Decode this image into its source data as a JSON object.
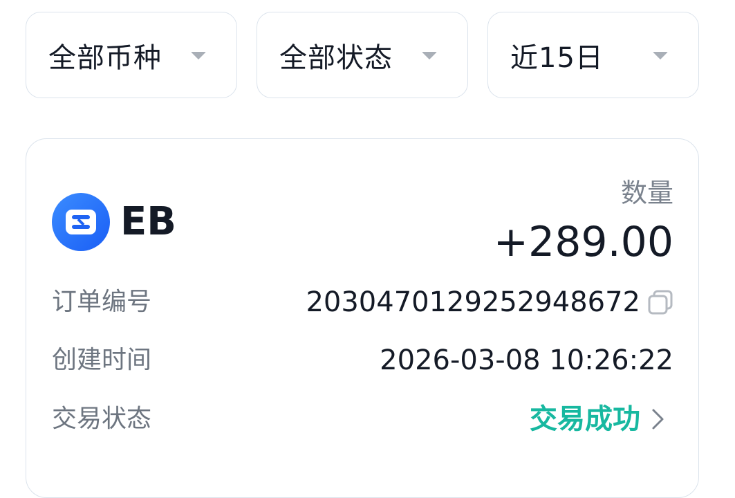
{
  "filters": {
    "currency": "全部币种",
    "status": "全部状态",
    "period": "近15日"
  },
  "record": {
    "coin": "EB",
    "quantity_label": "数量",
    "quantity_value": "+289.00",
    "order_no_label": "订单编号",
    "order_no_value": "2030470129252948672",
    "created_label": "创建时间",
    "created_value": "2026-03-08 10:26:22",
    "status_label": "交易状态",
    "status_value": "交易成功"
  },
  "colors": {
    "success": "#17b8a0",
    "brand_blue": "#1a5ef5",
    "border": "#dbe3ec",
    "muted_text": "#6d7580"
  },
  "icons": {
    "filter_caret": "caret-down-icon",
    "copy": "copy-icon",
    "status_arrow": "chevron-right-icon",
    "coin_logo": "eb-coin-logo"
  }
}
